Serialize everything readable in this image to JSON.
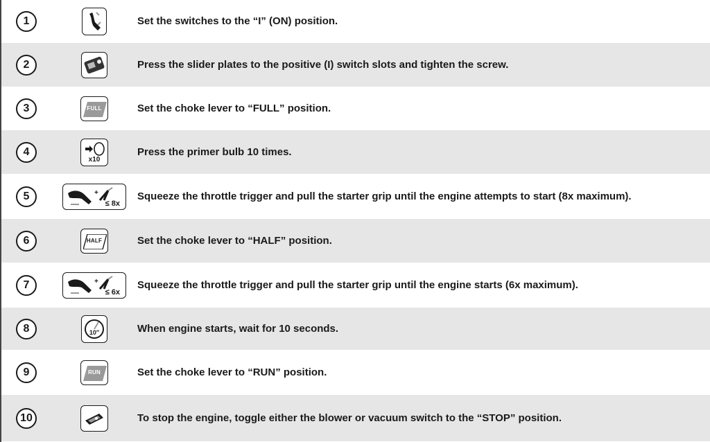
{
  "steps": [
    {
      "num": "1",
      "icon": "switch-on-icon",
      "text": "Set the switches to the “I” (ON) position."
    },
    {
      "num": "2",
      "icon": "slider-plate-icon",
      "text": "Press the slider plates to the positive (I)  switch slots and tighten the screw."
    },
    {
      "num": "3",
      "icon": "choke-full-icon",
      "label": "FULL",
      "text": "Set the choke lever to “FULL” position."
    },
    {
      "num": "4",
      "icon": "primer-bulb-icon",
      "label": "x10",
      "text": "Press the primer bulb 10 times."
    },
    {
      "num": "5",
      "icon": "throttle-starter-icon",
      "label": "≤ 8x",
      "text": "Squeeze the throttle trigger and pull the starter grip until the engine attempts to start (8x maximum)."
    },
    {
      "num": "6",
      "icon": "choke-half-icon",
      "label": "HALF",
      "text": "Set the choke lever to “HALF” position."
    },
    {
      "num": "7",
      "icon": "throttle-starter-icon",
      "label": "≤ 6x",
      "text": "Squeeze the throttle trigger and pull the starter grip until the engine starts (6x maximum)."
    },
    {
      "num": "8",
      "icon": "timer-icon",
      "label": "10″",
      "text": "When engine starts, wait for 10 seconds."
    },
    {
      "num": "9",
      "icon": "choke-run-icon",
      "label": "RUN",
      "text": "Set the choke lever to “RUN” position."
    },
    {
      "num": "10",
      "icon": "stop-switch-icon",
      "text": "To stop the engine, toggle either the blower or vacuum switch to the “STOP” position."
    }
  ]
}
